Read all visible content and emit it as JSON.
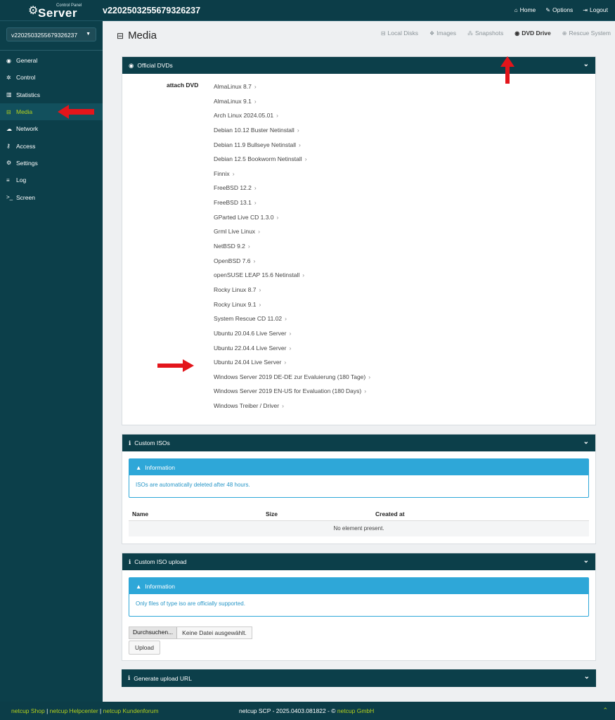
{
  "brand": {
    "small": "Control Panel",
    "name": "Server"
  },
  "server_id": "v2202503255679326237",
  "topnav": [
    {
      "icon": "home-icon",
      "glyph": "⌂",
      "label": "Home"
    },
    {
      "icon": "wrench-icon",
      "glyph": "✎",
      "label": "Options"
    },
    {
      "icon": "logout-icon",
      "glyph": "⇥",
      "label": "Logout"
    }
  ],
  "sidebar": {
    "selected_server": "v2202503255679326237",
    "items": [
      {
        "label": "General",
        "glyph": "◉",
        "icon": "eye-icon"
      },
      {
        "label": "Control",
        "glyph": "✲",
        "icon": "cog-icon"
      },
      {
        "label": "Statistics",
        "glyph": "▥",
        "icon": "bar-chart-icon"
      },
      {
        "label": "Media",
        "glyph": "⊟",
        "icon": "hdd-icon",
        "active": true
      },
      {
        "label": "Network",
        "glyph": "☁",
        "icon": "cloud-icon"
      },
      {
        "label": "Access",
        "glyph": "⚷",
        "icon": "key-icon"
      },
      {
        "label": "Settings",
        "glyph": "⚙",
        "icon": "cogs-icon"
      },
      {
        "label": "Log",
        "glyph": "≡",
        "icon": "list-icon"
      },
      {
        "label": "Screen",
        "glyph": ">_",
        "icon": "terminal-icon"
      }
    ]
  },
  "main": {
    "title": "Media",
    "tabs": [
      {
        "label": "Local Disks",
        "glyph": "⊟",
        "icon": "hdd-icon"
      },
      {
        "label": "Images",
        "glyph": "❖",
        "icon": "cubes-icon"
      },
      {
        "label": "Snapshots",
        "glyph": "⁂",
        "icon": "sitemap-icon"
      },
      {
        "label": "DVD Drive",
        "glyph": "◉",
        "icon": "dvd-icon",
        "active": true
      },
      {
        "label": "Rescue System",
        "glyph": "⊕",
        "icon": "lifebuoy-icon"
      }
    ]
  },
  "official_dvds": {
    "title": "Official DVDs",
    "attach_label": "attach DVD",
    "items": [
      "AlmaLinux 8.7",
      "AlmaLinux 9.1",
      "Arch Linux 2024.05.01",
      "Debian 10.12 Buster Netinstall",
      "Debian 11.9 Bullseye Netinstall",
      "Debian 12.5 Bookworm Netinstall",
      "Finnix",
      "FreeBSD 12.2",
      "FreeBSD 13.1",
      "GParted Live CD 1.3.0",
      "Grml Live Linux",
      "NetBSD 9.2",
      "OpenBSD 7.6",
      "openSUSE LEAP 15.6 Netinstall",
      "Rocky Linux 8.7",
      "Rocky Linux 9.1",
      "System Rescue CD 11.02",
      "Ubuntu 20.04.6 Live Server",
      "Ubuntu 22.04.4 Live Server",
      "Ubuntu 24.04 Live Server",
      "Windows Server 2019 DE-DE zur Evaluierung (180 Tage)",
      "Windows Server 2019 EN-US for Evaluation (180 Days)",
      "Windows Treiber / Driver"
    ]
  },
  "custom_isos": {
    "title": "Custom ISOs",
    "info_title": "Information",
    "info_text": "ISOs are automatically deleted after 48 hours.",
    "columns": [
      "Name",
      "Size",
      "Created at"
    ],
    "empty": "No element present."
  },
  "custom_iso_upload": {
    "title": "Custom ISO upload",
    "info_title": "Information",
    "info_text": "Only files of type iso are officially supported.",
    "browse_label": "Durchsuchen...",
    "no_file": "Keine Datei ausgewählt.",
    "upload_label": "Upload"
  },
  "generate_url": {
    "title": "Generate upload URL"
  },
  "footer": {
    "links": [
      "netcup Shop",
      "netcup Helpcenter",
      "netcup Kundenforum"
    ],
    "version": "netcup SCP - 2025.0403.081822 - ©",
    "company": "netcup GmbH"
  },
  "colors": {
    "accent": "#b6d21c",
    "header_bg": "#0c3f4a",
    "info_blue": "#2ea7d8",
    "arrow": "#e3151b"
  }
}
